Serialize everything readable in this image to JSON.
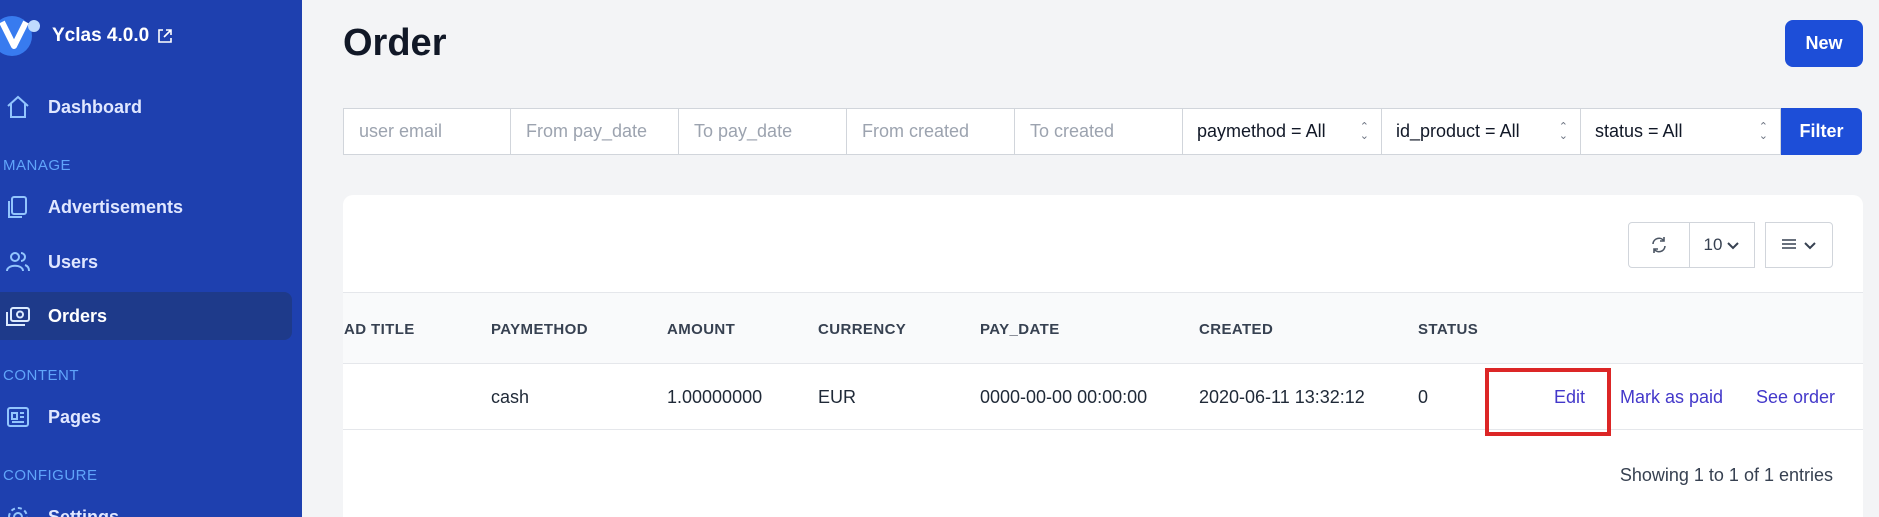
{
  "sidebar": {
    "brand": "Yclas 4.0.0",
    "items": [
      {
        "label": "Dashboard"
      },
      {
        "label": "Advertisements"
      },
      {
        "label": "Users"
      },
      {
        "label": "Orders"
      },
      {
        "label": "Pages"
      },
      {
        "label": "Settings"
      }
    ],
    "sections": {
      "manage": "MANAGE",
      "content": "CONTENT",
      "configure": "CONFIGURE"
    }
  },
  "header": {
    "title": "Order",
    "new_label": "New"
  },
  "filters": {
    "user_email_placeholder": "user email",
    "from_pay_date_placeholder": "From pay_date",
    "to_pay_date_placeholder": "To pay_date",
    "from_created_placeholder": "From created",
    "to_created_placeholder": "To created",
    "paymethod": "paymethod = All",
    "id_product": "id_product = All",
    "status": "status = All",
    "filter_label": "Filter"
  },
  "toolbar": {
    "page_size": "10"
  },
  "table": {
    "columns": [
      "AD TITLE",
      "PAYMETHOD",
      "AMOUNT",
      "CURRENCY",
      "PAY_DATE",
      "CREATED",
      "STATUS"
    ],
    "rows": [
      {
        "paymethod": "cash",
        "amount": "1.00000000",
        "currency": "EUR",
        "pay_date": "0000-00-00 00:00:00",
        "created": "2020-06-11 13:32:12",
        "status": "0"
      }
    ],
    "actions": {
      "edit": "Edit",
      "mark_paid": "Mark as paid",
      "see_order": "See order"
    },
    "footer": "Showing 1 to 1 of 1 entries"
  },
  "colors": {
    "sidebar": "#1e40af",
    "accent": "#1d4ed8",
    "highlight": "#dc2626"
  }
}
